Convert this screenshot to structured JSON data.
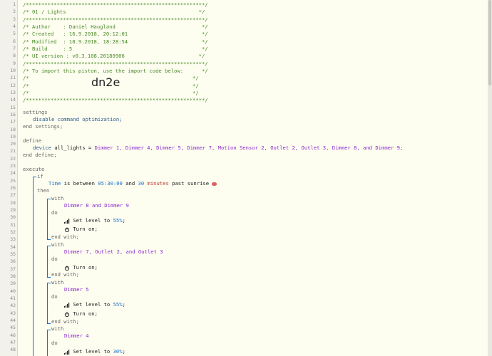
{
  "line_numbers": [
    "1",
    "2",
    "3",
    "4",
    "5",
    "6",
    "7",
    "8",
    "9",
    "10",
    "11",
    "12",
    "13",
    "14",
    "15",
    "16",
    "17",
    "18",
    "19",
    "20",
    "21",
    "22",
    "23",
    "24",
    "25",
    "26",
    "27",
    "28",
    "29",
    "30",
    "31",
    "32",
    "33",
    "34",
    "35",
    "36",
    "37",
    "38",
    "39",
    "40",
    "41",
    "42",
    "43",
    "44",
    "45",
    "46",
    "47",
    "48"
  ],
  "header": {
    "stars": "/**********************************************************/",
    "title": "/* 01 / Lights                                           */",
    "author": "/* Author    : Daniel Haugland                            */",
    "created": "/* Created   : 16.9.2018, 20:12:01                        */",
    "modified": "/* Modified  : 18.9.2018, 18:28:54                        */",
    "build": "/* Build     : 5                                          */",
    "ui_version": "/* UI version : v0.3.108.20180906                        */",
    "import_hint": "/* To import this piston, use the import code below:      */",
    "blank_open": "/*",
    "blank_close": "*/",
    "import_code": "dn2e"
  },
  "settings": {
    "kw": "settings",
    "line": "disable command optimization;",
    "end": "end settings;"
  },
  "define": {
    "kw": "define",
    "device_kw": "device",
    "var": "all_lights",
    "eq": " = ",
    "devices_text": "Dimmer 1, Dimmer 4, Dimmer 5, Dimmer 7, Motion Sensor 2, Outlet 2, Outlet 3, Dimmer 8, and Dimmer 9;",
    "end": "end define;"
  },
  "execute": {
    "kw": "execute",
    "if": "if",
    "cond_subject": "Time",
    "cond_is": " is between ",
    "cond_time": "05:30:00",
    "cond_and": " and ",
    "cond_num": "30",
    "cond_unit": " minutes",
    "cond_past": " past ",
    "cond_event": "sunrise",
    "then": "then",
    "with": "with",
    "do": "do",
    "end_with": "end with;",
    "blocks": [
      {
        "devices": "Dimmer 8 and Dimmer 9",
        "cmd1": "Set level to ",
        "val1": "55%",
        "cmd2": "Turn on;"
      },
      {
        "devices": "Dimmer 7, Outlet 2, and Outlet 3",
        "cmd1": "Turn on;"
      },
      {
        "devices": "Dimmer 5",
        "cmd1": "Set level to ",
        "val1": "55%",
        "cmd2": "Turn on;"
      },
      {
        "devices": "Dimmer 4",
        "cmd1": "Set level to ",
        "val1": "30%"
      }
    ],
    "semicolon": ";"
  }
}
